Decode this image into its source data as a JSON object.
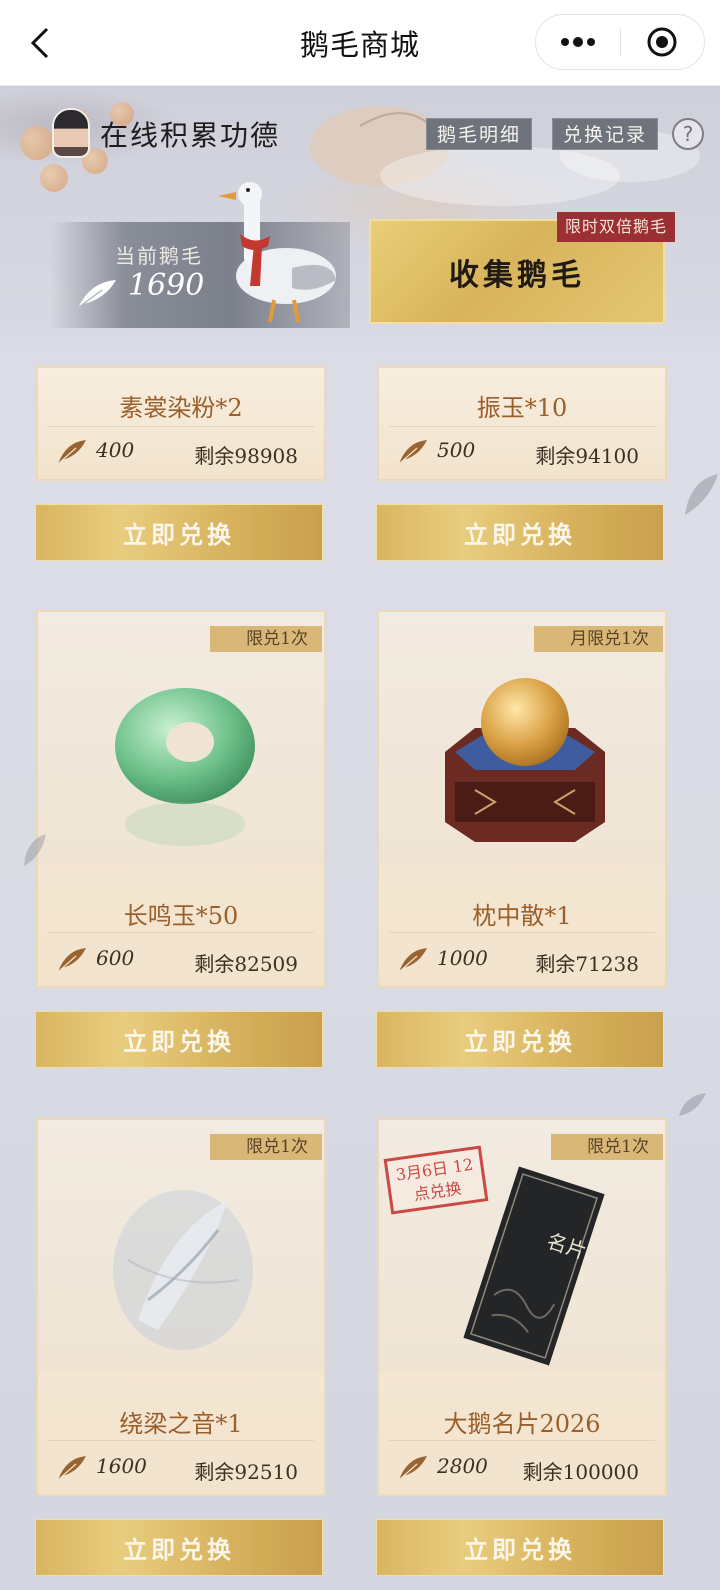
{
  "nav": {
    "title": "鹅毛商城"
  },
  "header": {
    "merit_title": "在线积累功德",
    "feather_detail_label": "鹅毛明细",
    "exchange_record_label": "兑换记录",
    "help_label": "?",
    "balance_label": "当前鹅毛",
    "balance_value": "1690",
    "collect_label": "收集鹅毛",
    "double_tag": "限时双倍鹅毛"
  },
  "redeem_label": "立即兑换",
  "items": [
    {
      "name": "素裳染粉*2",
      "price": "400",
      "stock": "剩余98908",
      "limit": ""
    },
    {
      "name": "振玉*10",
      "price": "500",
      "stock": "剩余94100",
      "limit": ""
    },
    {
      "name": "长鸣玉*50",
      "price": "600",
      "stock": "剩余82509",
      "limit": "限兑1次"
    },
    {
      "name": "枕中散*1",
      "price": "1000",
      "stock": "剩余71238",
      "limit": "月限兑1次"
    },
    {
      "name": "绕梁之音*1",
      "price": "1600",
      "stock": "剩余92510",
      "limit": "限兑1次"
    },
    {
      "name": "大鹅名片2026",
      "price": "2800",
      "stock": "剩余100000",
      "limit": "限兑1次",
      "stamp": "3月6日 12点兑换",
      "card_text": "名片"
    }
  ],
  "colors": {
    "gold": "#d9b561",
    "item_name": "#9b5f2b",
    "tag_bg": "#6f737c",
    "double_tag_bg": "#9c2f33"
  }
}
